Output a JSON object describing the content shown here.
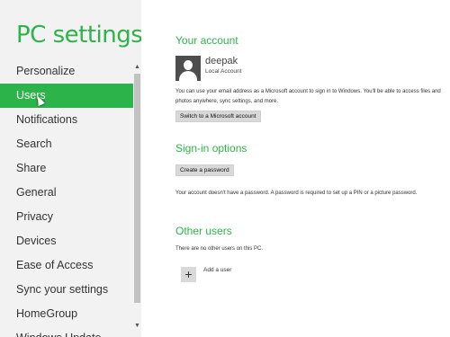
{
  "app": {
    "title": "PC settings"
  },
  "nav": {
    "items": [
      "Personalize",
      "Users",
      "Notifications",
      "Search",
      "Share",
      "General",
      "Privacy",
      "Devices",
      "Ease of Access",
      "Sync your settings",
      "HomeGroup",
      "Windows Update"
    ],
    "selected": "Users"
  },
  "account": {
    "title": "Your account",
    "user_name": "deepak",
    "account_type": "Local Account",
    "description": "You can use your email address as a Microsoft account to sign in to Windows. You'll be able to access files and photos anywhere, sync settings, and more.",
    "switch_button": "Switch to a Microsoft account"
  },
  "signin": {
    "title": "Sign-in options",
    "create_button": "Create a password",
    "description": "Your account doesn't have a password. A password is required to set up a PIN or a picture password."
  },
  "others": {
    "title": "Other users",
    "description": "There are no other users on this PC.",
    "add_label": "Add a user"
  },
  "colors": {
    "accent": "#2cb34a",
    "sidebar_bg": "#f2f2f2"
  },
  "icons": {
    "add": "plus-icon",
    "avatar": "user-icon"
  }
}
